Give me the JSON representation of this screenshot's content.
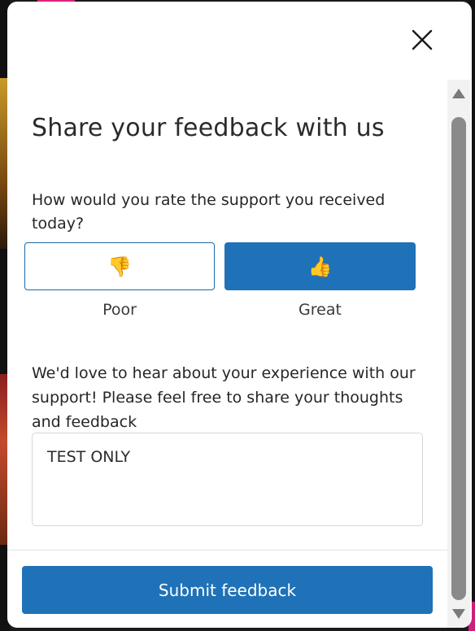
{
  "dialog": {
    "heading": "Share your feedback with us",
    "rating_question": "How would you rate the support you received today?",
    "rating_options": [
      {
        "label": "Poor",
        "icon": "thumbs-down-icon",
        "glyph": "👎",
        "selected": false
      },
      {
        "label": "Great",
        "icon": "thumbs-up-icon",
        "glyph": "👍",
        "selected": true
      }
    ],
    "feedback_prompt": "We'd love to hear about your experience with our support! Please feel free to share your thoughts and feedback",
    "feedback_value": "TEST ONLY",
    "submit_label": "Submit feedback",
    "close_icon": "close-icon"
  },
  "colors": {
    "accent": "#1f72b7",
    "heading_text": "#2b2b2b",
    "background": "#ffffff"
  }
}
